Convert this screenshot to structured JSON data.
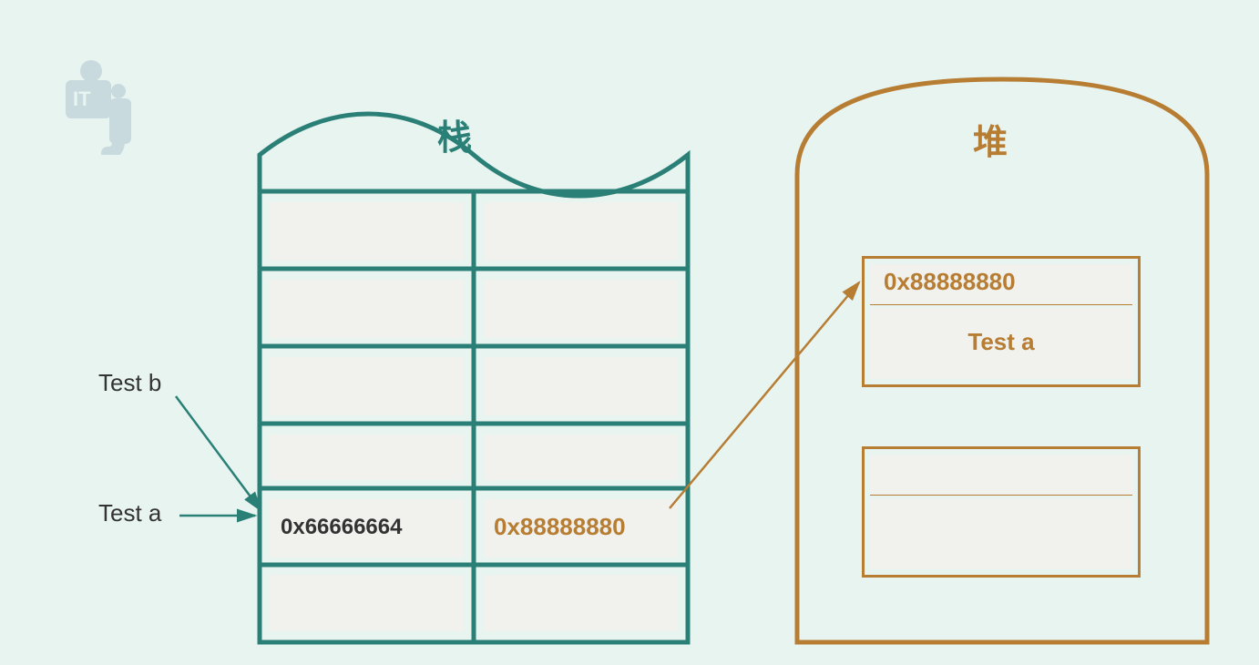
{
  "labels": {
    "test_b": "Test b",
    "test_a": "Test a"
  },
  "stack": {
    "title": "栈",
    "row5_left": "0x66666664",
    "row5_right": "0x88888880"
  },
  "heap": {
    "title": "堆",
    "box1_addr": "0x88888880",
    "box1_label": "Test a"
  },
  "colors": {
    "teal": "#2a8076",
    "brown": "#b67d33",
    "bg": "#e8f4f0",
    "cell": "#f1f1ee"
  }
}
